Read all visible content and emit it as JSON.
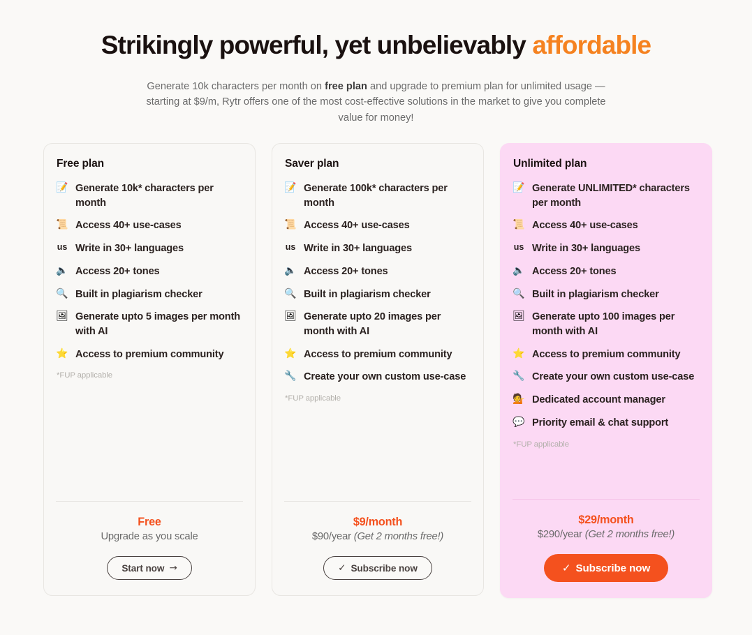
{
  "hero": {
    "title_part1": "Strikingly powerful, yet unbelievably ",
    "title_accent": "affordable",
    "sub_part1": "Generate 10k characters per month on ",
    "sub_bold": "free plan",
    "sub_part2": " and upgrade to premium plan for unlimited usage — starting at $9/m, Rytr offers one of the most cost-effective solutions in the market to give you complete value for money!"
  },
  "accent_colors": {
    "heading_orange": "#f58220",
    "price_orange": "#f4511e",
    "featured_pink": "#fcd9f4",
    "page_background": "#faf9f7"
  },
  "plans": [
    {
      "name": "Free plan",
      "featured": false,
      "features": [
        {
          "icon": "memo",
          "glyph": "📝",
          "label": "Generate 10k* characters per month"
        },
        {
          "icon": "scroll",
          "glyph": "📜",
          "label": "Access 40+ use-cases"
        },
        {
          "icon": "us-flag",
          "glyph": "us",
          "label": "Write in 30+ languages"
        },
        {
          "icon": "speaker",
          "glyph": "🔈",
          "label": "Access 20+ tones"
        },
        {
          "icon": "magnifier",
          "glyph": "🔍",
          "label": "Built in plagiarism checker"
        },
        {
          "icon": "framed-picture",
          "glyph": "🖼",
          "label": "Generate upto 5 images per month with AI"
        },
        {
          "icon": "star",
          "glyph": "⭐",
          "label": "Access to premium community"
        }
      ],
      "fup": "*FUP applicable",
      "price_main": "Free",
      "price_sub": "Upgrade as you scale",
      "price_sub_italic": "",
      "cta_label": "Start now",
      "cta_glyph": "→",
      "cta_glyph_position": "after",
      "cta_style": "outline"
    },
    {
      "name": "Saver plan",
      "featured": false,
      "features": [
        {
          "icon": "memo",
          "glyph": "📝",
          "label": "Generate 100k* characters per month"
        },
        {
          "icon": "scroll",
          "glyph": "📜",
          "label": "Access 40+ use-cases"
        },
        {
          "icon": "us-flag",
          "glyph": "us",
          "label": "Write in 30+ languages"
        },
        {
          "icon": "speaker",
          "glyph": "🔈",
          "label": "Access 20+ tones"
        },
        {
          "icon": "magnifier",
          "glyph": "🔍",
          "label": "Built in plagiarism checker"
        },
        {
          "icon": "framed-picture",
          "glyph": "🖼",
          "label": "Generate upto 20 images per month with AI"
        },
        {
          "icon": "star",
          "glyph": "⭐",
          "label": "Access to premium community"
        },
        {
          "icon": "wrench",
          "glyph": "🔧",
          "label": "Create your own custom use-case"
        }
      ],
      "fup": "*FUP applicable",
      "price_main": "$9/month",
      "price_sub": "$90/year ",
      "price_sub_italic": "(Get 2 months free!)",
      "cta_label": "Subscribe now",
      "cta_glyph": "✓",
      "cta_glyph_position": "before",
      "cta_style": "outline"
    },
    {
      "name": "Unlimited plan",
      "featured": true,
      "features": [
        {
          "icon": "memo",
          "glyph": "📝",
          "label": "Generate UNLIMITED* characters per month"
        },
        {
          "icon": "scroll",
          "glyph": "📜",
          "label": "Access 40+ use-cases"
        },
        {
          "icon": "us-flag",
          "glyph": "us",
          "label": "Write in 30+ languages"
        },
        {
          "icon": "speaker",
          "glyph": "🔈",
          "label": "Access 20+ tones"
        },
        {
          "icon": "magnifier",
          "glyph": "🔍",
          "label": "Built in plagiarism checker"
        },
        {
          "icon": "framed-picture",
          "glyph": "🖼",
          "label": "Generate upto 100 images per month with AI"
        },
        {
          "icon": "star",
          "glyph": "⭐",
          "label": "Access to premium community"
        },
        {
          "icon": "wrench",
          "glyph": "🔧",
          "label": "Create your own custom use-case"
        },
        {
          "icon": "person-in-suit",
          "glyph": "💁",
          "label": "Dedicated account manager"
        },
        {
          "icon": "speech-balloon",
          "glyph": "💬",
          "label": "Priority email & chat support"
        }
      ],
      "fup": "*FUP applicable",
      "price_main": "$29/month",
      "price_sub": "$290/year ",
      "price_sub_italic": "(Get 2 months free!)",
      "cta_label": "Subscribe now",
      "cta_glyph": "✓",
      "cta_glyph_position": "before",
      "cta_style": "solid"
    }
  ]
}
